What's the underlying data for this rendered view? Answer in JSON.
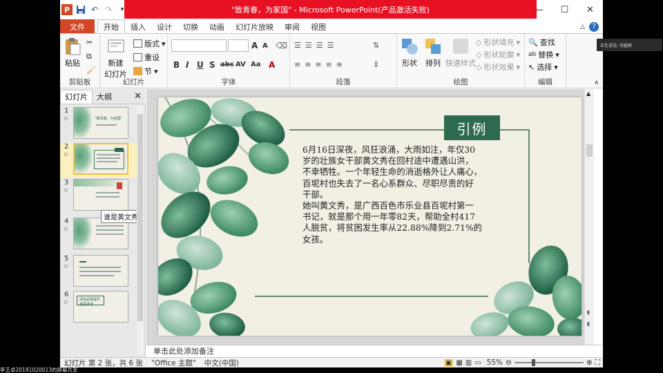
{
  "window": {
    "title": "\"致青春，为家国\" - Microsoft PowerPoint(产品激活失败)",
    "controls": [
      "minimize-icon",
      "maximize-icon",
      "close-icon"
    ]
  },
  "quick_access": [
    "save-icon",
    "undo-icon",
    "redo-icon",
    "customize-icon"
  ],
  "tabs": [
    {
      "label": "文件",
      "active": false
    },
    {
      "label": "开始",
      "active": true
    },
    {
      "label": "插入",
      "active": false
    },
    {
      "label": "设计",
      "active": false
    },
    {
      "label": "切换",
      "active": false
    },
    {
      "label": "动画",
      "active": false
    },
    {
      "label": "幻灯片放映",
      "active": false
    },
    {
      "label": "审阅",
      "active": false
    },
    {
      "label": "视图",
      "active": false
    }
  ],
  "ribbon": {
    "clipboard": {
      "paste": "粘贴",
      "label": "剪贴板"
    },
    "slides": {
      "new_slide": "新建\n幻灯片",
      "layout": "版式",
      "reset": "重设",
      "section": "节",
      "label": "幻灯片"
    },
    "font": {
      "label": "字体",
      "bold": "B",
      "italic": "I",
      "underline": "U",
      "shadow": "S",
      "strike": "abc",
      "spacing": "AV",
      "case": "Aa",
      "color": "A",
      "grow": "A",
      "shrink": "A"
    },
    "paragraph": {
      "label": "段落"
    },
    "drawing": {
      "shapes": "形状",
      "arrange": "排列",
      "quick_styles": "快速样式",
      "fill": "形状填充",
      "outline": "形状轮廓",
      "effects": "形状效果",
      "label": "绘图"
    },
    "editing": {
      "find": "查找",
      "replace": "替换",
      "select": "选择",
      "label": "编辑"
    }
  },
  "pane": {
    "tab_slides": "幻灯片",
    "tab_outline": "大纲",
    "thumbnails": [
      {
        "num": "1",
        "selected": false,
        "caption": "“致青春，为家国”"
      },
      {
        "num": "2",
        "selected": true,
        "caption": "引例"
      },
      {
        "num": "3",
        "selected": false,
        "caption": ""
      },
      {
        "num": "4",
        "selected": false,
        "caption": ""
      },
      {
        "num": "5",
        "selected": false,
        "caption": ""
      },
      {
        "num": "6",
        "selected": false,
        "caption": "活动总结提升\n宣誓承诺"
      }
    ],
    "tooltip": "谁是黄文秀"
  },
  "slide": {
    "title": "引例",
    "body": "6月16日深夜，风狂浪涌，大雨如注，年仅30\n岁的壮族女干部黄文秀在回村途中遭遇山洪，\n不幸牺牲。一个年轻生命的消逝格外让人痛心，\n百坭村也失去了一名心系群众、尽职尽责的好\n干部。\n她叫黄文秀，是广西百色市乐业县百坭村第一\n书记，就是那个用一年零82天，帮助全村417\n人脱贫，将贫困发生率从22.88%降到2.71%的\n女孩。"
  },
  "notes": {
    "placeholder": "单击此处添加备注"
  },
  "status": {
    "slide_info": "幻灯片 第 2 张，共 6 张",
    "theme": "\"Office 主题\"",
    "language": "中文(中国)",
    "zoom": "55%",
    "zoom_fraction": 0.55
  },
  "overlay": {
    "share_text": "正在讲话: 司越峡",
    "caption": "李王卓20181020013的屏幕共享"
  },
  "colors": {
    "accent": "#d24726",
    "title_strip": "#e81123",
    "slide_green": "#2d6a4f",
    "slide_bg": "#f2efe4"
  }
}
